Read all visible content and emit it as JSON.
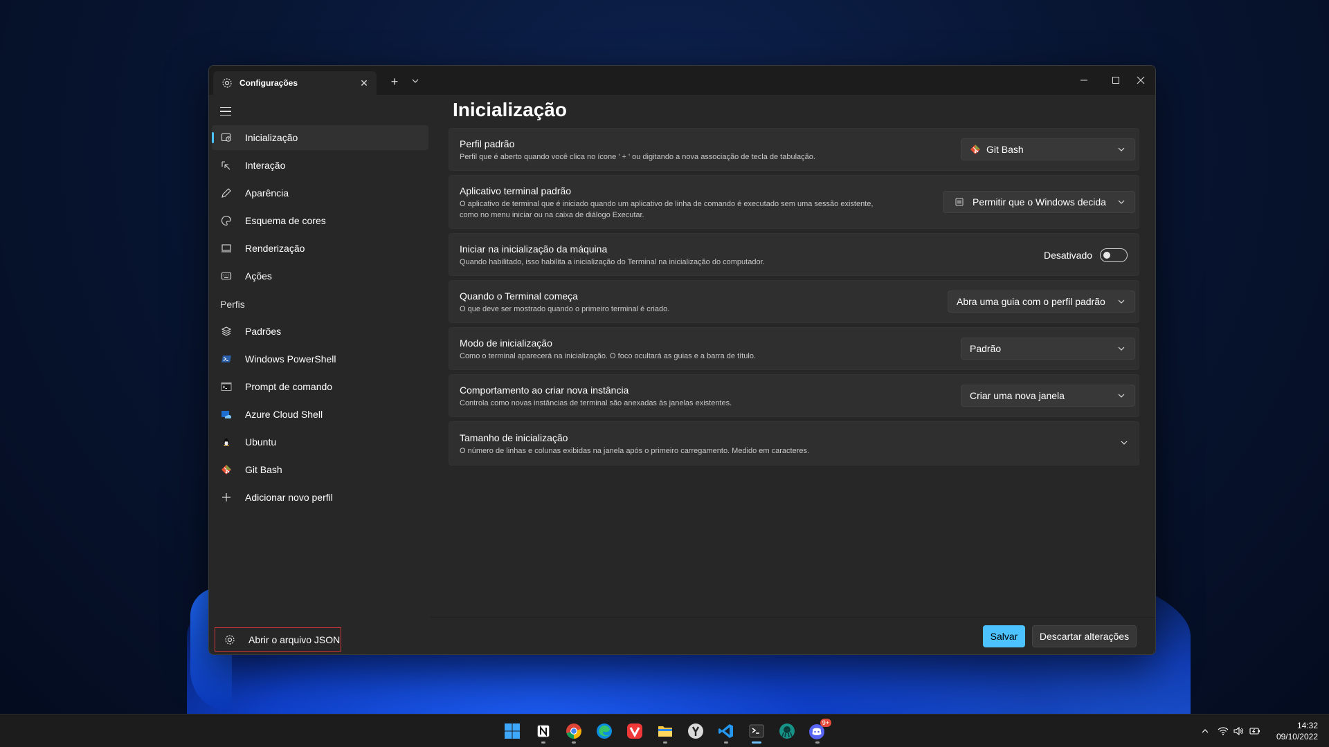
{
  "window": {
    "tab_title": "Configurações"
  },
  "sidebar": {
    "items": [
      {
        "label": "Inicialização",
        "icon": "startup-icon",
        "active": true
      },
      {
        "label": "Interação",
        "icon": "interaction-icon"
      },
      {
        "label": "Aparência",
        "icon": "pen-icon"
      },
      {
        "label": "Esquema de cores",
        "icon": "palette-icon"
      },
      {
        "label": "Renderização",
        "icon": "monitor-icon"
      },
      {
        "label": "Ações",
        "icon": "keyboard-icon"
      }
    ],
    "profiles_header": "Perfis",
    "profiles": [
      {
        "label": "Padrões",
        "icon": "layers-icon"
      },
      {
        "label": "Windows PowerShell",
        "icon": "powershell-icon"
      },
      {
        "label": "Prompt de comando",
        "icon": "cmd-icon"
      },
      {
        "label": "Azure Cloud Shell",
        "icon": "azure-icon"
      },
      {
        "label": "Ubuntu",
        "icon": "ubuntu-icon"
      },
      {
        "label": "Git Bash",
        "icon": "git-icon"
      },
      {
        "label": "Adicionar novo perfil",
        "icon": "plus-icon"
      }
    ],
    "open_json": "Abrir o arquivo JSON"
  },
  "main": {
    "title": "Inicialização",
    "default_profile": {
      "title": "Perfil padrão",
      "desc": "Perfil que é aberto quando você clica no ícone ' + ' ou digitando a nova associação de tecla de tabulação.",
      "value": "Git Bash"
    },
    "default_terminal": {
      "title": "Aplicativo terminal padrão",
      "desc_line1": "O aplicativo de terminal que é iniciado quando um aplicativo de linha de comando é executado sem uma sessão existente,",
      "desc_line2": "como no menu iniciar ou na caixa de diálogo Executar.",
      "value": "Permitir que o Windows decida"
    },
    "launch_on_startup": {
      "title": "Iniciar na inicialização da máquina",
      "desc": "Quando habilitado, isso habilita a inicialização do Terminal na inicialização do computador.",
      "state_label": "Desativado",
      "on": false
    },
    "when_terminal_starts": {
      "title": "Quando o Terminal começa",
      "desc": "O que deve ser mostrado quando o primeiro terminal é criado.",
      "value": "Abra uma guia com o perfil padrão"
    },
    "launch_mode": {
      "title": "Modo de inicialização",
      "desc": "Como o terminal aparecerá na inicialização. O foco ocultará as guias e a barra de título.",
      "value": "Padrão"
    },
    "new_instance": {
      "title": "Comportamento ao criar nova instância",
      "desc": "Controla como novas instâncias de terminal são anexadas às janelas existentes.",
      "value": "Criar uma nova janela"
    },
    "launch_size": {
      "title": "Tamanho de inicialização",
      "desc": "O número de linhas e colunas exibidas na janela após o primeiro carregamento. Medido em caracteres."
    },
    "save": "Salvar",
    "discard": "Descartar alterações"
  },
  "taskbar": {
    "apps": [
      "windows-start-icon",
      "notion-icon",
      "chrome-icon",
      "edge-icon",
      "vivaldi-icon",
      "file-explorer-icon",
      "yandex-browser-icon",
      "vscode-icon",
      "terminal-icon",
      "gitkraken-icon",
      "discord-icon"
    ],
    "discord_badge": "9+",
    "time": "14:32",
    "date": "09/10/2022"
  },
  "colors": {
    "accent": "#4cc2ff",
    "highlight_border": "#d13438"
  }
}
